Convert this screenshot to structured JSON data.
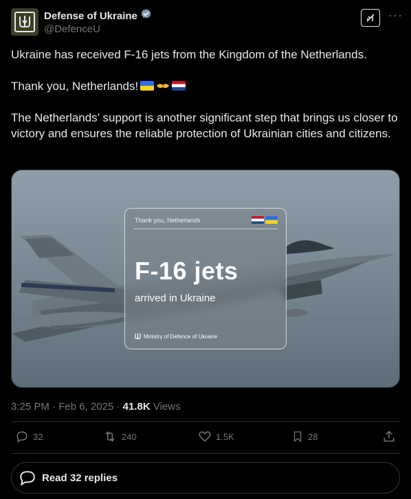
{
  "author": {
    "display_name": "Defense of Ukraine",
    "handle": "@DefenceU",
    "verified_icon": "verified-badge-icon",
    "avatar_icon": "trident-icon"
  },
  "header_actions": {
    "grok_icon": "grok-icon",
    "more_label": "···"
  },
  "tweet": {
    "line1": "Ukraine has received F-16 jets from the Kingdom of the Netherlands.",
    "line2": "Thank you, Netherlands!",
    "line2_emoji": [
      "flag-ukraine",
      "handshake",
      "flag-netherlands"
    ],
    "line3": "The Netherlands’ support is another significant step that brings us closer to victory and ensures the reliable protection of Ukrainian cities and citizens."
  },
  "media": {
    "card_header": "Thank you, Netherlands",
    "card_title": "F-16 jets",
    "card_subtitle": "arrived in Ukraine",
    "card_footer": "Ministry of Defence of Ukraine",
    "flags": [
      "flag-netherlands",
      "flag-ukraine"
    ]
  },
  "meta": {
    "time": "3:25 PM",
    "separator": " · ",
    "date": "Feb 6, 2025",
    "views_count": "41.8K",
    "views_label": "Views"
  },
  "actions": {
    "replies": "32",
    "reposts": "240",
    "likes": "1.5K",
    "bookmarks": "28"
  },
  "read_replies": {
    "label": "Read 32 replies"
  },
  "colors": {
    "background": "#000000",
    "text": "#e7e9ea",
    "muted": "#71767b",
    "border": "#2f3336",
    "verified": "#829aab"
  }
}
